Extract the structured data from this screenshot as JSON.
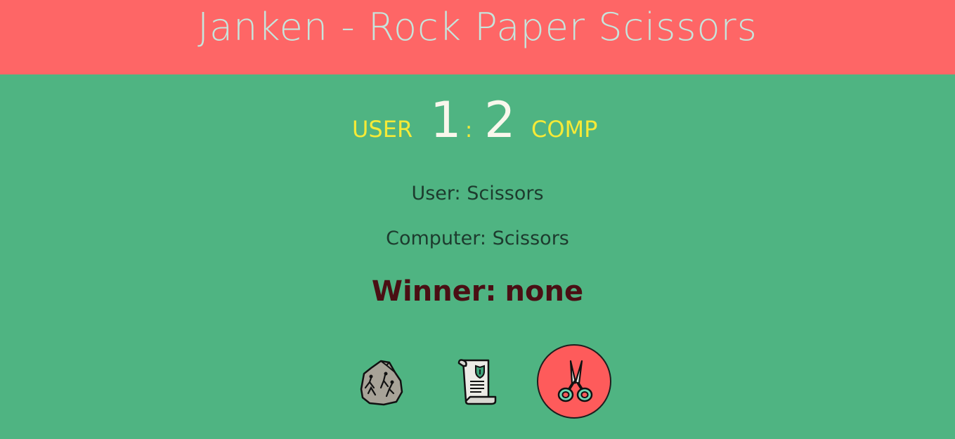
{
  "header": {
    "title": "Janken - Rock Paper Scissors"
  },
  "scoreboard": {
    "user_label": "USER",
    "comp_label": "COMP",
    "separator": ":",
    "user_score": "1",
    "comp_score": "2"
  },
  "result": {
    "user_choice_prefix": "User:",
    "user_choice": "Scissors",
    "comp_choice_prefix": "Computer:",
    "comp_choice": "Scissors",
    "winner_prefix": "Winner:",
    "winner": "none"
  },
  "choices": [
    {
      "name": "rock",
      "icon": "rock-icon",
      "selected": false
    },
    {
      "name": "paper",
      "icon": "paper-scroll-icon",
      "selected": false
    },
    {
      "name": "scissors",
      "icon": "scissors-icon",
      "selected": true
    }
  ],
  "colors": {
    "header_bg": "#fe6666",
    "page_bg": "#4fb482",
    "title": "#c6e5dc",
    "score_label": "#f5ea37",
    "score_number": "#f9f7ec",
    "winner_text": "#4a0f14",
    "selected_button_bg": "#fe5b5b"
  }
}
